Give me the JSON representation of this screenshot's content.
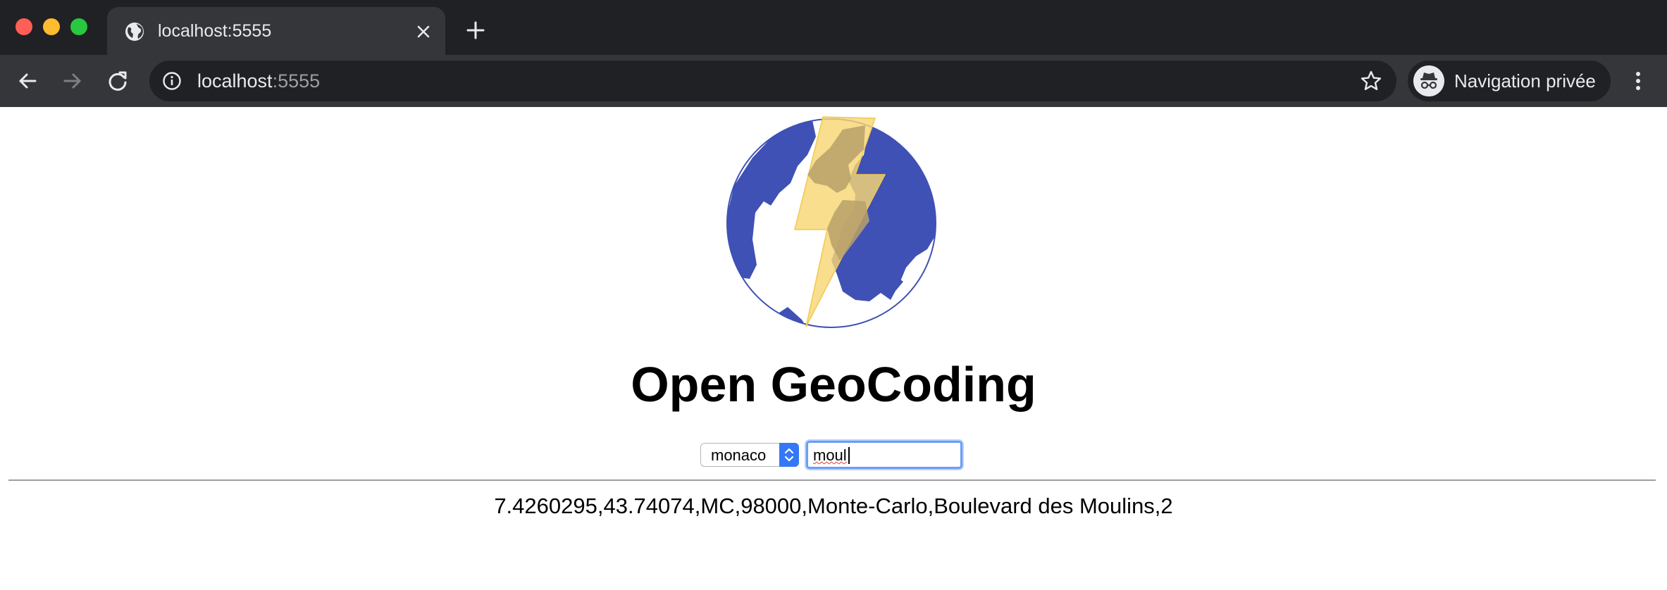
{
  "browser": {
    "tab": {
      "title": "localhost:5555",
      "icon": "globe-icon"
    },
    "url": {
      "host": "localhost",
      "port": ":5555"
    },
    "profile_label": "Navigation privée",
    "colors": {
      "chrome_dark": "#202124",
      "chrome_toolbar": "#35363a",
      "text": "#e8eaed"
    }
  },
  "page": {
    "logo": "globe-lightning-logo",
    "title": "Open GeoCoding",
    "country_select": {
      "value": "monaco"
    },
    "search": {
      "value": "moul"
    },
    "result": "7.4260295,43.74074,MC,98000,Monte-Carlo,Boulevard des Moulins,2",
    "colors": {
      "globe_blue": "#3f51b5",
      "bolt_yellow": "#f7d774",
      "focus_ring": "#6a9df5",
      "select_accent": "#3478f6"
    }
  }
}
